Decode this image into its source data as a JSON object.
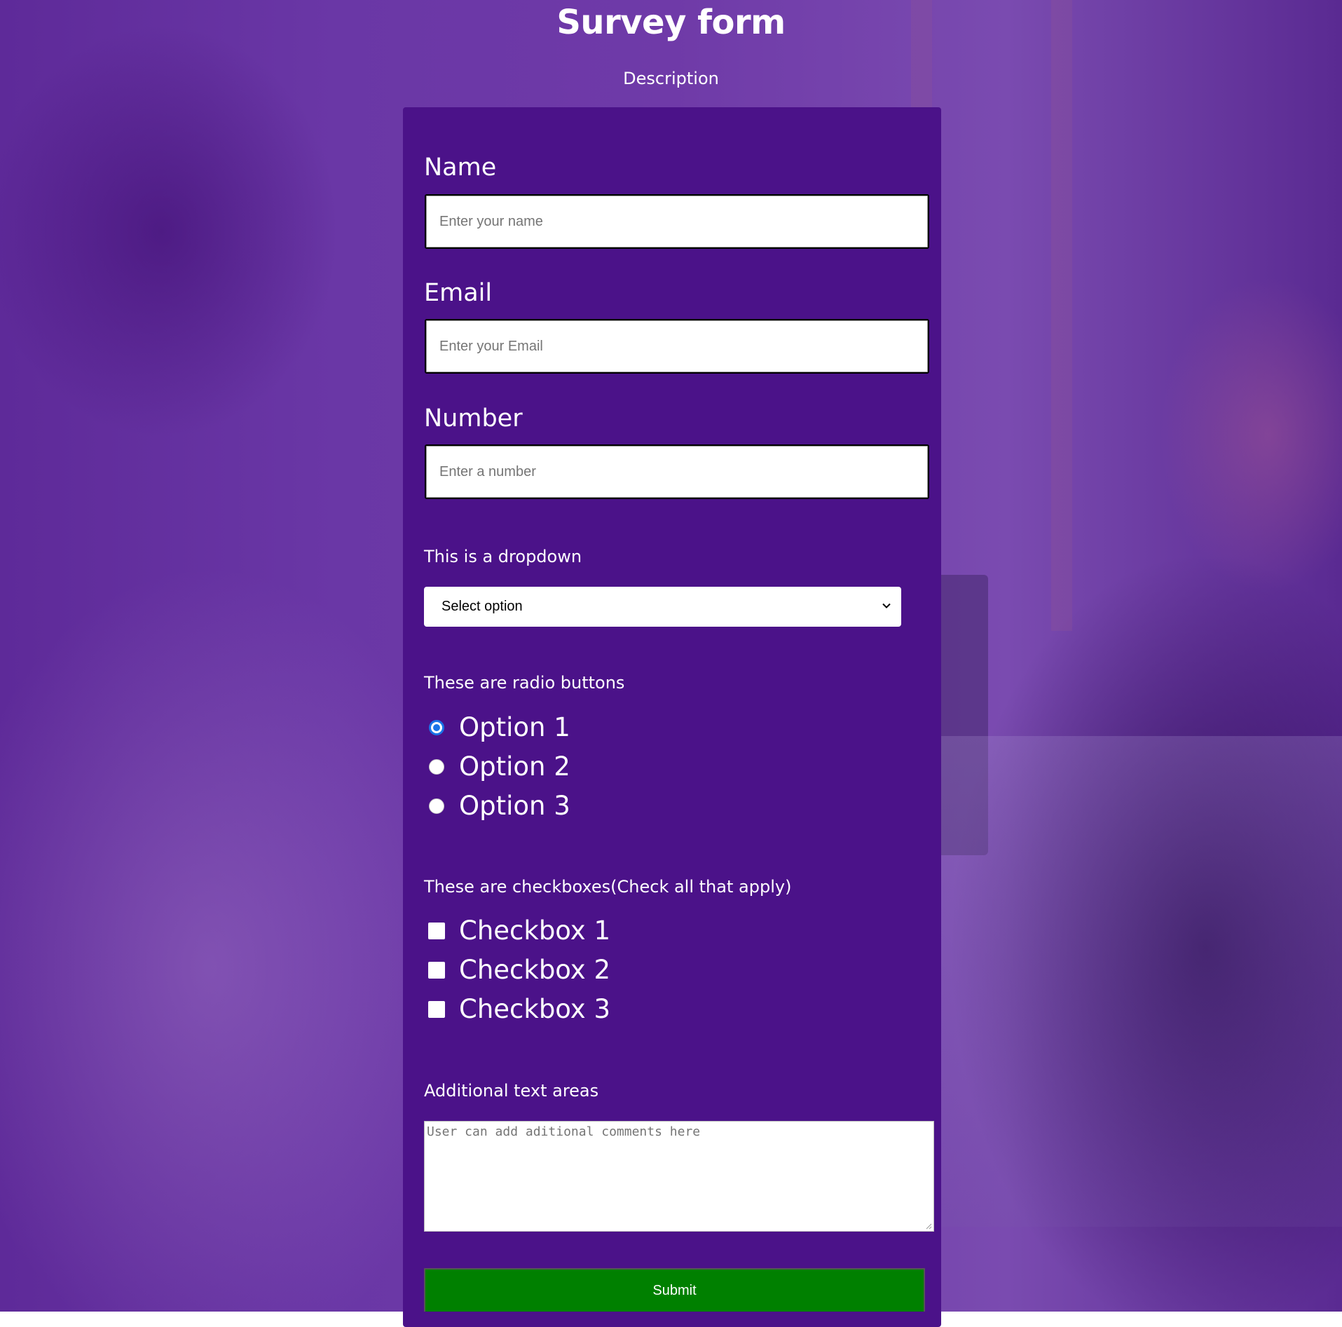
{
  "header": {
    "title": "Survey form",
    "description": "Description"
  },
  "form": {
    "name": {
      "label": "Name",
      "placeholder": "Enter your name"
    },
    "email": {
      "label": "Email",
      "placeholder": "Enter your Email"
    },
    "number": {
      "label": "Number",
      "placeholder": "Enter a number"
    },
    "dropdown": {
      "label": "This is a dropdown",
      "selected": "Select option"
    },
    "radios": {
      "label": "These are radio buttons",
      "options": [
        {
          "label": "Option 1",
          "checked": true
        },
        {
          "label": "Option 2",
          "checked": false
        },
        {
          "label": "Option 3",
          "checked": false
        }
      ]
    },
    "checkboxes": {
      "label": "These are checkboxes(Check all that apply)",
      "options": [
        {
          "label": "Checkbox 1",
          "checked": false
        },
        {
          "label": "Checkbox 2",
          "checked": false
        },
        {
          "label": "Checkbox 3",
          "checked": false
        }
      ]
    },
    "textarea": {
      "label": "Additional text areas",
      "placeholder": "User can add aditional comments here"
    },
    "submit_label": "Submit"
  },
  "colors": {
    "panel": "#4b1289",
    "submit": "#008000",
    "radio_accent": "#1a73e8"
  }
}
